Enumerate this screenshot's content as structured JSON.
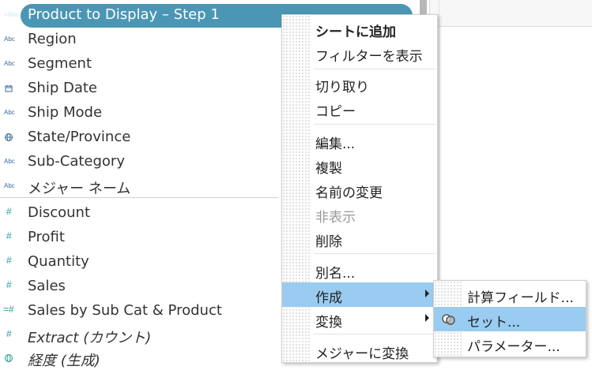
{
  "fields": [
    {
      "icon": "=Abc",
      "label": "Product to Display – Step 1",
      "selected": true
    },
    {
      "icon": "Abc",
      "label": "Region"
    },
    {
      "icon": "Abc",
      "label": "Segment"
    },
    {
      "icon": "calendar",
      "label": "Ship Date"
    },
    {
      "icon": "Abc",
      "label": "Ship Mode"
    },
    {
      "icon": "globe",
      "label": "State/Province"
    },
    {
      "icon": "Abc",
      "label": "Sub-Category"
    },
    {
      "icon": "Abc",
      "label": "メジャー ネーム"
    },
    {
      "icon": "#",
      "label": "Discount"
    },
    {
      "icon": "#",
      "label": "Profit"
    },
    {
      "icon": "#",
      "label": "Quantity"
    },
    {
      "icon": "#",
      "label": "Sales"
    },
    {
      "icon": "=#",
      "label": "Sales by Sub Cat & Product"
    },
    {
      "icon": "#",
      "label": "Extract (カウント)"
    },
    {
      "icon": "globe",
      "label": "経度 (生成)"
    }
  ],
  "context_menu": {
    "items": [
      {
        "label": "シートに追加",
        "bold": true
      },
      {
        "label": "フィルターを表示"
      },
      {
        "label": "切り取り"
      },
      {
        "label": "コピー"
      },
      {
        "label": "編集..."
      },
      {
        "label": "複製"
      },
      {
        "label": "名前の変更"
      },
      {
        "label": "非表示",
        "disabled": true
      },
      {
        "label": "削除"
      },
      {
        "label": "別名..."
      },
      {
        "label": "作成",
        "submenu": true,
        "highlighted": true
      },
      {
        "label": "変換",
        "submenu": true
      },
      {
        "label": "メジャーに変換"
      }
    ]
  },
  "submenu": {
    "items": [
      {
        "label": "計算フィールド..."
      },
      {
        "label": "セット...",
        "highlighted": true,
        "icon": "set-icon"
      },
      {
        "label": "パラメーター..."
      }
    ]
  },
  "colors": {
    "selected_pill": "#4a96b4",
    "menu_highlight": "#99ccf0"
  }
}
